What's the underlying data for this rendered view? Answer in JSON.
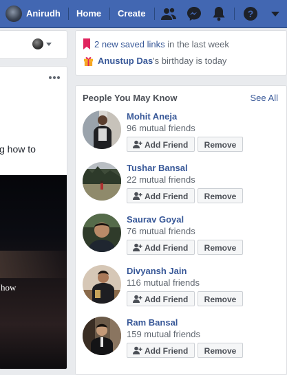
{
  "topbar": {
    "user_name": "Anirudh",
    "home_label": "Home",
    "create_label": "Create",
    "icons": [
      "friend-requests-icon",
      "messenger-icon",
      "notifications-icon",
      "help-icon",
      "account-menu-caret-icon"
    ],
    "color": "#4267b2"
  },
  "left_post": {
    "text": "g how to",
    "video_caption": "how"
  },
  "notices": {
    "saved": {
      "link": "2 new saved links",
      "suffix": " in the last week",
      "icon": "bookmark-icon"
    },
    "birthday": {
      "name": "Anustup Das",
      "suffix": "'s birthday is today",
      "icon": "gift-icon"
    }
  },
  "pymk": {
    "title": "People You May Know",
    "see_all": "See All",
    "add_label": "Add Friend",
    "remove_label": "Remove",
    "people": [
      {
        "name": "Mohit Aneja",
        "mutual": "96 mutual friends"
      },
      {
        "name": "Tushar Bansal",
        "mutual": "22 mutual friends"
      },
      {
        "name": "Saurav Goyal",
        "mutual": "76 mutual friends"
      },
      {
        "name": "Divyansh Jain",
        "mutual": "116 mutual friends"
      },
      {
        "name": "Ram Bansal",
        "mutual": "159 mutual friends"
      }
    ]
  },
  "colors": {
    "link": "#385898",
    "background": "#e9ebee"
  }
}
